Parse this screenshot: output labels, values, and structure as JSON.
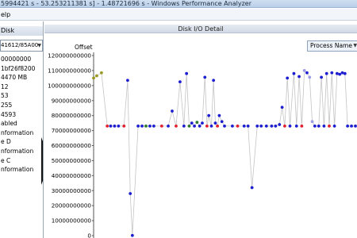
{
  "window": {
    "title": "5994421 s - 53.253211381 s] - 1.48721696 s - Windows Performance Analyzer"
  },
  "menu": {
    "items": [
      "elp"
    ]
  },
  "left_panel": {
    "header": "Disk",
    "disk_select": "41612/85A00",
    "properties": [
      "00000000",
      "1bf26f8200",
      "4470 MB",
      "12",
      "53",
      "255",
      "4593",
      "abled",
      "nformation",
      "e D",
      "nformation",
      "e C",
      "nformation"
    ]
  },
  "main": {
    "header": "Disk I/O Detail",
    "group_by": "Process Name"
  },
  "chart_data": {
    "type": "scatter",
    "title": "",
    "xlabel": "",
    "ylabel": "Offset",
    "ylim": [
      0,
      120000000000
    ],
    "ytick_labels": [
      "0",
      "10000000000",
      "20000000000",
      "30000000000",
      "40000000000",
      "50000000000",
      "60000000000",
      "70000000000",
      "80000000000",
      "90000000000",
      "100000000000",
      "110000000000",
      "120000000000"
    ],
    "xlim": [
      0,
      100
    ],
    "grid": false,
    "colors": {
      "blue": "#1d1ecf",
      "red": "#e0202c",
      "green": "#2f7a2f",
      "olive": "#9a9a22",
      "lightblue": "#9d9de6",
      "line": "#c4c4c4"
    },
    "series": [
      {
        "connected": true,
        "points": [
          {
            "x": 0.0,
            "y": 105000000000,
            "c": "olive"
          },
          {
            "x": 1.2,
            "y": 106500000000,
            "c": "olive"
          },
          {
            "x": 3.0,
            "y": 108500000000,
            "c": "olive"
          },
          {
            "x": 5.2,
            "y": 73000000000,
            "c": "red"
          },
          {
            "x": 6.5,
            "y": 73000000000,
            "c": "blue"
          },
          {
            "x": 8.0,
            "y": 73000000000,
            "c": "blue"
          },
          {
            "x": 9.5,
            "y": 73000000000,
            "c": "blue"
          },
          {
            "x": 11.6,
            "y": 73000000000,
            "c": "red"
          },
          {
            "x": 13.0,
            "y": 103500000000,
            "c": "blue"
          },
          {
            "x": 14.0,
            "y": 28000000000,
            "c": "blue"
          },
          {
            "x": 14.8,
            "y": 100000000,
            "c": "blue"
          },
          {
            "x": 17.0,
            "y": 73000000000,
            "c": "blue"
          },
          {
            "x": 18.5,
            "y": 73000000000,
            "c": "blue"
          },
          {
            "x": 20.0,
            "y": 73000000000,
            "c": "green"
          },
          {
            "x": 21.5,
            "y": 73000000000,
            "c": "blue"
          },
          {
            "x": 23.0,
            "y": 73000000000,
            "c": "blue"
          },
          {
            "x": 26.0,
            "y": 73000000000,
            "c": "red"
          },
          {
            "x": 28.5,
            "y": 73000000000,
            "c": "blue"
          },
          {
            "x": 30.0,
            "y": 83000000000,
            "c": "blue"
          },
          {
            "x": 31.5,
            "y": 73000000000,
            "c": "red"
          },
          {
            "x": 33.0,
            "y": 102500000000,
            "c": "blue"
          },
          {
            "x": 34.5,
            "y": 73000000000,
            "c": "blue"
          },
          {
            "x": 35.5,
            "y": 108000000000,
            "c": "blue"
          },
          {
            "x": 36.5,
            "y": 73000000000,
            "c": "green"
          },
          {
            "x": 37.5,
            "y": 75000000000,
            "c": "blue"
          },
          {
            "x": 38.5,
            "y": 73000000000,
            "c": "blue"
          },
          {
            "x": 39.5,
            "y": 75500000000,
            "c": "green"
          },
          {
            "x": 40.5,
            "y": 73000000000,
            "c": "blue"
          },
          {
            "x": 41.5,
            "y": 75000000000,
            "c": "blue"
          },
          {
            "x": 42.5,
            "y": 105500000000,
            "c": "blue"
          },
          {
            "x": 43.3,
            "y": 73000000000,
            "c": "red"
          },
          {
            "x": 44.0,
            "y": 80000000000,
            "c": "blue"
          },
          {
            "x": 45.0,
            "y": 73000000000,
            "c": "blue"
          },
          {
            "x": 45.8,
            "y": 103500000000,
            "c": "blue"
          },
          {
            "x": 46.5,
            "y": 75000000000,
            "c": "blue"
          },
          {
            "x": 47.3,
            "y": 73000000000,
            "c": "red"
          },
          {
            "x": 48.0,
            "y": 80000000000,
            "c": "blue"
          },
          {
            "x": 49.0,
            "y": 76000000000,
            "c": "blue"
          },
          {
            "x": 50.0,
            "y": 73000000000,
            "c": "blue"
          },
          {
            "x": 53.0,
            "y": 73000000000,
            "c": "blue"
          },
          {
            "x": 55.0,
            "y": 73000000000,
            "c": "red"
          },
          {
            "x": 57.5,
            "y": 73000000000,
            "c": "blue"
          },
          {
            "x": 59.0,
            "y": 73000000000,
            "c": "blue"
          },
          {
            "x": 60.5,
            "y": 32000000000,
            "c": "blue"
          },
          {
            "x": 62.5,
            "y": 73000000000,
            "c": "blue"
          },
          {
            "x": 64.0,
            "y": 73000000000,
            "c": "blue"
          },
          {
            "x": 66.0,
            "y": 73000000000,
            "c": "blue"
          },
          {
            "x": 68.0,
            "y": 73000000000,
            "c": "blue"
          },
          {
            "x": 69.5,
            "y": 73000000000,
            "c": "blue"
          },
          {
            "x": 71.0,
            "y": 74000000000,
            "c": "blue"
          },
          {
            "x": 72.0,
            "y": 85500000000,
            "c": "blue"
          },
          {
            "x": 73.0,
            "y": 73000000000,
            "c": "red"
          },
          {
            "x": 74.0,
            "y": 105000000000,
            "c": "blue"
          },
          {
            "x": 75.0,
            "y": 73000000000,
            "c": "blue"
          },
          {
            "x": 76.5,
            "y": 108000000000,
            "c": "blue"
          },
          {
            "x": 77.5,
            "y": 73000000000,
            "c": "blue"
          },
          {
            "x": 78.5,
            "y": 106000000000,
            "c": "blue"
          },
          {
            "x": 79.5,
            "y": 73000000000,
            "c": "red"
          },
          {
            "x": 80.5,
            "y": 110000000000,
            "c": "lightblue"
          },
          {
            "x": 81.5,
            "y": 108500000000,
            "c": "blue"
          },
          {
            "x": 82.5,
            "y": 105500000000,
            "c": "lightblue"
          },
          {
            "x": 83.5,
            "y": 76000000000,
            "c": "lightblue"
          },
          {
            "x": 84.5,
            "y": 73000000000,
            "c": "blue"
          },
          {
            "x": 86.0,
            "y": 73000000000,
            "c": "blue"
          },
          {
            "x": 87.0,
            "y": 105500000000,
            "c": "blue"
          },
          {
            "x": 88.0,
            "y": 73000000000,
            "c": "blue"
          },
          {
            "x": 89.0,
            "y": 108000000000,
            "c": "blue"
          },
          {
            "x": 90.0,
            "y": 73000000000,
            "c": "red"
          },
          {
            "x": 91.0,
            "y": 108500000000,
            "c": "blue"
          },
          {
            "x": 92.0,
            "y": 73000000000,
            "c": "blue"
          },
          {
            "x": 93.0,
            "y": 108000000000,
            "c": "blue"
          },
          {
            "x": 94.0,
            "y": 107500000000,
            "c": "blue"
          },
          {
            "x": 95.0,
            "y": 108500000000,
            "c": "blue"
          },
          {
            "x": 96.0,
            "y": 108000000000,
            "c": "blue"
          },
          {
            "x": 97.0,
            "y": 73000000000,
            "c": "blue"
          },
          {
            "x": 98.5,
            "y": 73000000000,
            "c": "blue"
          },
          {
            "x": 100.0,
            "y": 73000000000,
            "c": "blue"
          }
        ]
      }
    ]
  }
}
